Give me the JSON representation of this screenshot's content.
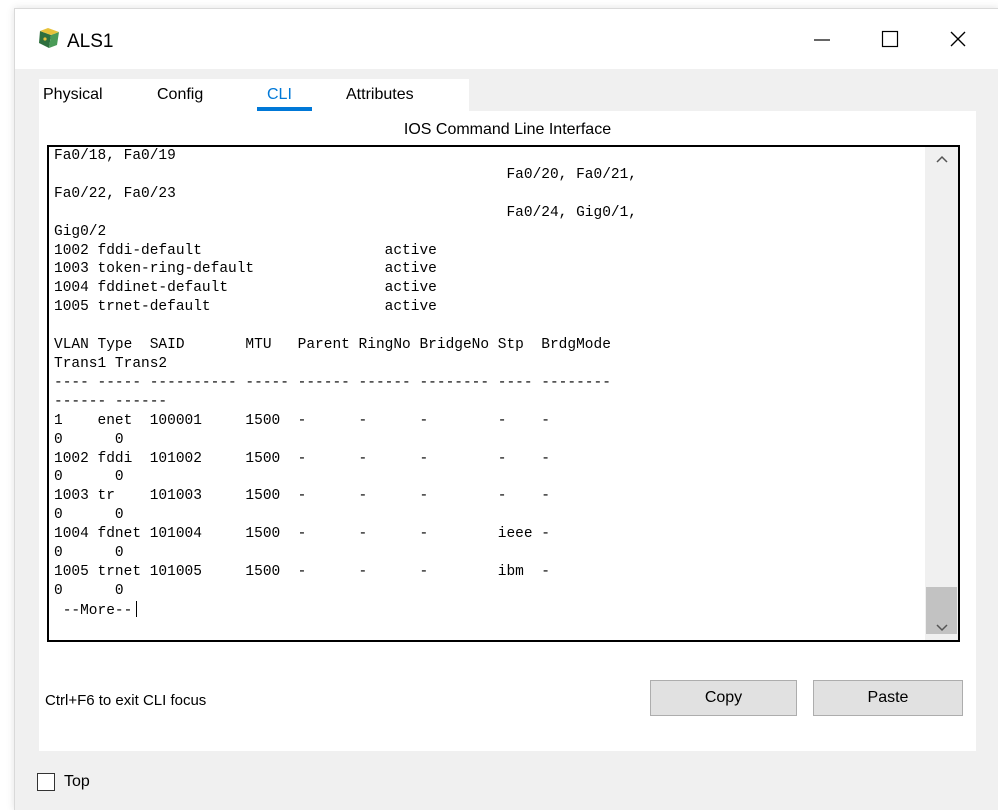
{
  "window": {
    "title": "ALS1",
    "icon": "router-device-icon"
  },
  "tabs": [
    {
      "label": "Physical",
      "active": false
    },
    {
      "label": "Config",
      "active": false
    },
    {
      "label": "CLI",
      "active": true
    },
    {
      "label": "Attributes",
      "active": false
    }
  ],
  "cli": {
    "caption": "IOS Command Line Interface",
    "lines": [
      "Fa0/18, Fa0/19",
      "                                                    Fa0/20, Fa0/21,",
      "Fa0/22, Fa0/23",
      "                                                    Fa0/24, Gig0/1,",
      "Gig0/2",
      "1002 fddi-default                     active",
      "1003 token-ring-default               active",
      "1004 fddinet-default                  active",
      "1005 trnet-default                    active",
      "",
      "VLAN Type  SAID       MTU   Parent RingNo BridgeNo Stp  BrdgMode",
      "Trans1 Trans2",
      "---- ----- ---------- ----- ------ ------ -------- ---- --------",
      "------ ------",
      "1    enet  100001     1500  -      -      -        -    -",
      "0      0",
      "1002 fddi  101002     1500  -      -      -        -    -",
      "0      0",
      "1003 tr    101003     1500  -      -      -        -    -",
      "0      0",
      "1004 fdnet 101004     1500  -      -      -        ieee -",
      "0      0",
      "1005 trnet 101005     1500  -      -      -        ibm  -",
      "0      0"
    ],
    "prompt": " --More--"
  },
  "footer": {
    "hint": "Ctrl+F6 to exit CLI focus",
    "copy_label": "Copy",
    "paste_label": "Paste"
  },
  "top_checkbox": {
    "label": "Top",
    "checked": false
  },
  "colors": {
    "accent": "#0078d7",
    "client_bg": "#f0f0f0",
    "button_bg": "#e1e1e1"
  }
}
